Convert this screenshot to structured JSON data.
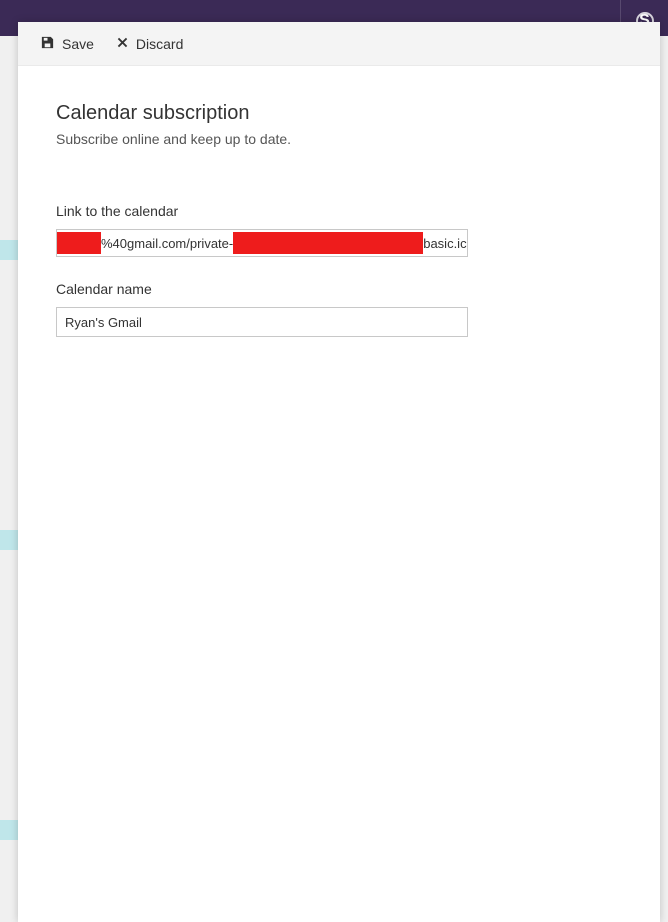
{
  "topbar": {
    "skype_label": "S"
  },
  "actions": {
    "save_label": "Save",
    "discard_label": "Discard"
  },
  "page": {
    "title": "Calendar subscription",
    "subtitle": "Subscribe online and keep up to date."
  },
  "fields": {
    "link": {
      "label": "Link to the calendar",
      "segment_mid": "%40gmail.com/private-",
      "segment_end": "basic.ics"
    },
    "name": {
      "label": "Calendar name",
      "value": "Ryan's Gmail"
    }
  }
}
